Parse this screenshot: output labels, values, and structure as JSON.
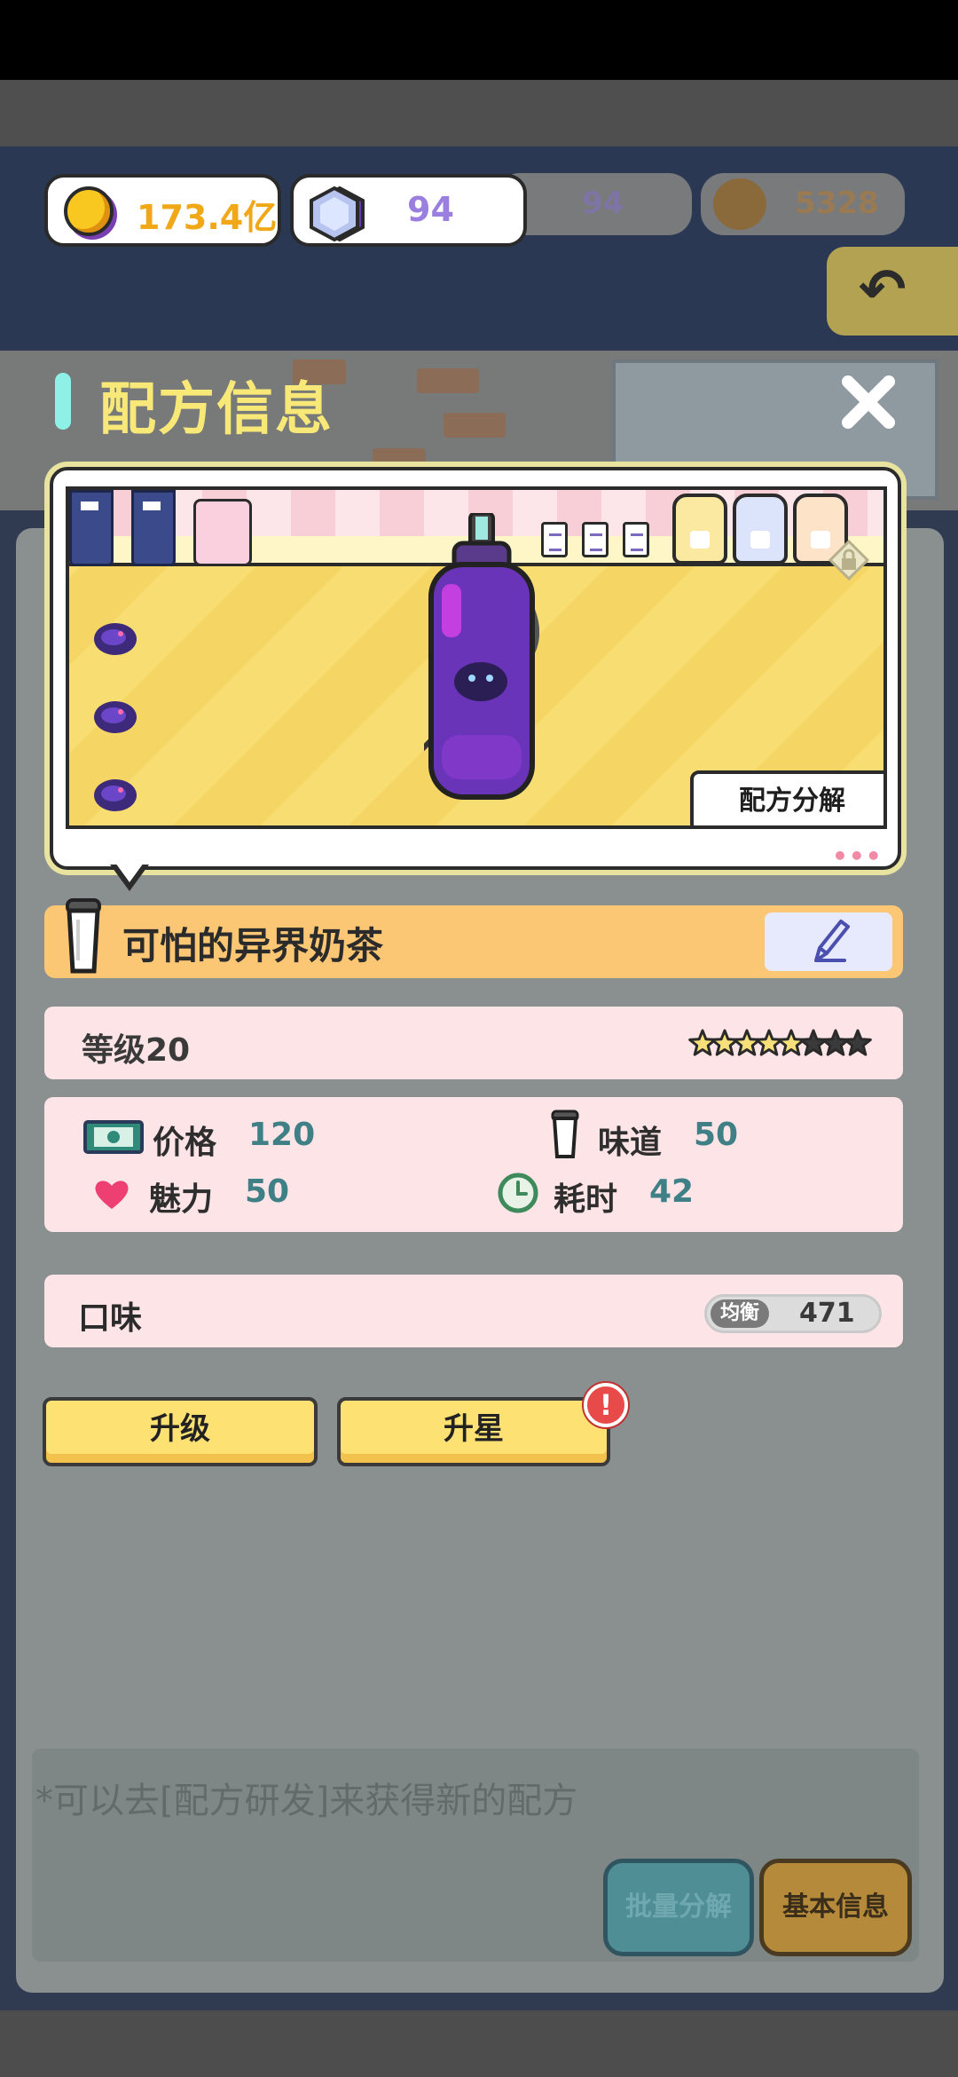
{
  "currency": {
    "coin": "173.4亿",
    "gem": "94",
    "bg_gem": "94",
    "bg_pudding": "5328"
  },
  "dialog": {
    "title": "配方信息"
  },
  "preview": {
    "decompose_label": "配方分解",
    "more_indicator": "•••"
  },
  "recipe": {
    "name": "可怕的异界奶茶",
    "level_label": "等级20",
    "stars_total": 8,
    "stars_filled": 5,
    "stats": {
      "price_label": "价格",
      "price_value": "120",
      "flavor_label": "味道",
      "flavor_value": "50",
      "charm_label": "魅力",
      "charm_value": "50",
      "time_label": "耗时",
      "time_value": "42"
    },
    "taste": {
      "label": "口味",
      "badge": "均衡",
      "value": "471"
    }
  },
  "actions": {
    "upgrade": "升级",
    "star_up": "升星",
    "alert": "!"
  },
  "background": {
    "hint": "*可以去[配方研发]来获得新的配方",
    "batch_decompose": "批量分解",
    "basic_info": "基本信息"
  },
  "colors": {
    "coin_text": "#f0a818",
    "gem_text": "#9a7fe0",
    "title_text": "#f8e878",
    "stat_value": "#3f7f86",
    "name_bar": "#fcc775",
    "panel": "#fde4e6",
    "button": "#fde173",
    "alert": "#e84a4a"
  }
}
